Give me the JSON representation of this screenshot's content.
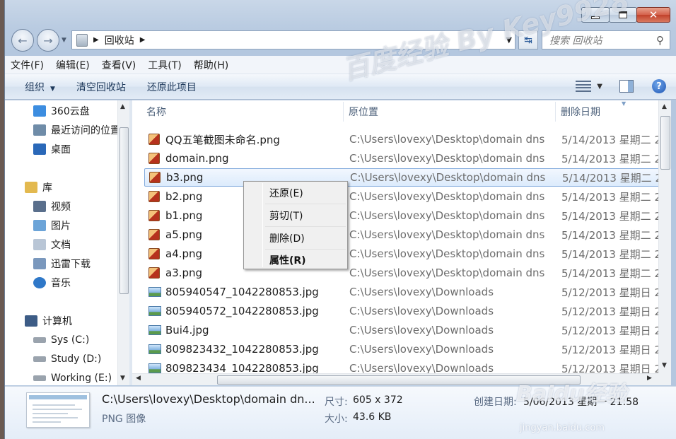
{
  "window": {
    "caption_buttons": {
      "minimize_icon": "minimize-icon",
      "maximize_icon": "maximize-icon",
      "close_icon": "close-icon",
      "close_glyph": "✕"
    }
  },
  "address_bar": {
    "location": "回收站",
    "search_placeholder": "搜索 回收站"
  },
  "menu": [
    "文件(F)",
    "编辑(E)",
    "查看(V)",
    "工具(T)",
    "帮助(H)"
  ],
  "toolbar": {
    "organize": "组织",
    "empty_recycle_bin": "清空回收站",
    "restore_this_item": "还原此项目"
  },
  "nav": {
    "favorites": [
      "360云盘",
      "最近访问的位置",
      "桌面"
    ],
    "libraries_header": "库",
    "libraries": [
      "视频",
      "图片",
      "文档",
      "迅雷下载",
      "音乐"
    ],
    "computer_header": "计算机",
    "drives": [
      "Sys (C:)",
      "Study (D:)",
      "Working (E:)"
    ]
  },
  "columns": {
    "name": "名称",
    "original_location": "原位置",
    "date_deleted": "删除日期"
  },
  "files": [
    {
      "name": "QQ五笔截图未命名.png",
      "location": "C:\\Users\\lovexy\\Desktop\\domain dns",
      "date": "5/14/2013 星期二 2",
      "type": "png"
    },
    {
      "name": "domain.png",
      "location": "C:\\Users\\lovexy\\Desktop\\domain dns",
      "date": "5/14/2013 星期二 2",
      "type": "png"
    },
    {
      "name": "b3.png",
      "location": "C:\\Users\\lovexy\\Desktop\\domain dns",
      "date": "5/14/2013 星期二 2",
      "type": "png",
      "selected": true
    },
    {
      "name": "b2.png",
      "location": "C:\\Users\\lovexy\\Desktop\\domain dns",
      "date": "5/14/2013 星期二 2",
      "type": "png"
    },
    {
      "name": "b1.png",
      "location": "C:\\Users\\lovexy\\Desktop\\domain dns",
      "date": "5/14/2013 星期二 2",
      "type": "png"
    },
    {
      "name": "a5.png",
      "location": "C:\\Users\\lovexy\\Desktop\\domain dns",
      "date": "5/14/2013 星期二 2",
      "type": "png"
    },
    {
      "name": "a4.png",
      "location": "C:\\Users\\lovexy\\Desktop\\domain dns",
      "date": "5/14/2013 星期二 2",
      "type": "png"
    },
    {
      "name": "a3.png",
      "location": "C:\\Users\\lovexy\\Desktop\\domain dns",
      "date": "5/14/2013 星期二 2",
      "type": "png"
    },
    {
      "name": "805940547_1042280853.jpg",
      "location": "C:\\Users\\lovexy\\Downloads",
      "date": "5/12/2013 星期日 2",
      "type": "jpg"
    },
    {
      "name": "805940572_1042280853.jpg",
      "location": "C:\\Users\\lovexy\\Downloads",
      "date": "5/12/2013 星期日 2",
      "type": "jpg"
    },
    {
      "name": "Bui4.jpg",
      "location": "C:\\Users\\lovexy\\Downloads",
      "date": "5/12/2013 星期日 2",
      "type": "jpg"
    },
    {
      "name": "809823432_1042280853.jpg",
      "location": "C:\\Users\\lovexy\\Downloads",
      "date": "5/12/2013 星期日 2",
      "type": "jpg"
    },
    {
      "name": "809823434_1042280853.jpg",
      "location": "C:\\Users\\lovexy\\Downloads",
      "date": "5/12/2013 星期日 2",
      "type": "jpg"
    }
  ],
  "context_menu": {
    "restore": "还原(E)",
    "cut": "剪切(T)",
    "delete": "删除(D)",
    "properties": "属性(R)"
  },
  "details": {
    "path": "C:\\Users\\lovexy\\Desktop\\domain dn...",
    "type": "PNG 图像",
    "dimensions_label": "尺寸:",
    "dimensions_value": "605 x 372",
    "size_label": "大小:",
    "size_value": "43.6 KB",
    "created_label": "创建日期:",
    "created_value": "5/06/2013 星期一 21:58"
  },
  "watermarks": {
    "main": "百度经验 By Key9928",
    "baidu": "Baidu经验",
    "site": "jingyan.baidu.com"
  }
}
